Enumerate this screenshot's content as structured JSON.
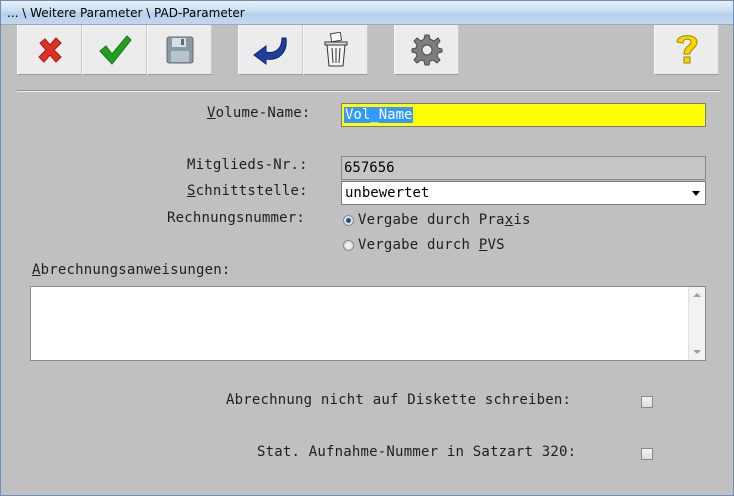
{
  "window": {
    "title": "... \\ Weitere Parameter \\ PAD-Parameter"
  },
  "toolbar": {
    "buttons": [
      {
        "icon": "close-x-icon"
      },
      {
        "icon": "checkmark-icon"
      },
      {
        "icon": "floppy-save-icon"
      },
      {
        "icon": "undo-arrow-icon"
      },
      {
        "icon": "trash-bin-icon"
      },
      {
        "icon": "gear-icon"
      },
      {
        "icon": "help-question-icon"
      }
    ]
  },
  "form": {
    "volume_name": {
      "label_pre": "",
      "label_ul": "V",
      "label_post": "olume-Name:",
      "value": "Vol_Name"
    },
    "mitglieds_nr": {
      "label": "Mitglieds-Nr.:",
      "value": "657656"
    },
    "schnittstelle": {
      "label_ul": "S",
      "label_post": "chnittstelle:",
      "value": "unbewertet"
    },
    "rechnungsnummer": {
      "label": "Rechnungsnummer:",
      "option1_pre": "Vergabe durch Pra",
      "option1_ul": "x",
      "option1_post": "is",
      "option2_pre": "Vergabe durch ",
      "option2_ul": "P",
      "option2_post": "VS",
      "selected": "option1"
    },
    "abrechnung": {
      "label_ul": "A",
      "label_post": "brechnungsanweisungen:",
      "value": ""
    },
    "diskette": {
      "label": "Abrechnung nicht auf Diskette schreiben:",
      "checked": false
    },
    "stat": {
      "label": "Stat. Aufnahme-Nummer in Satzart 320:",
      "checked": false
    }
  },
  "colors": {
    "background": "#c0c0c0",
    "highlight_field": "#ffff00",
    "selection": "#3399ff"
  }
}
